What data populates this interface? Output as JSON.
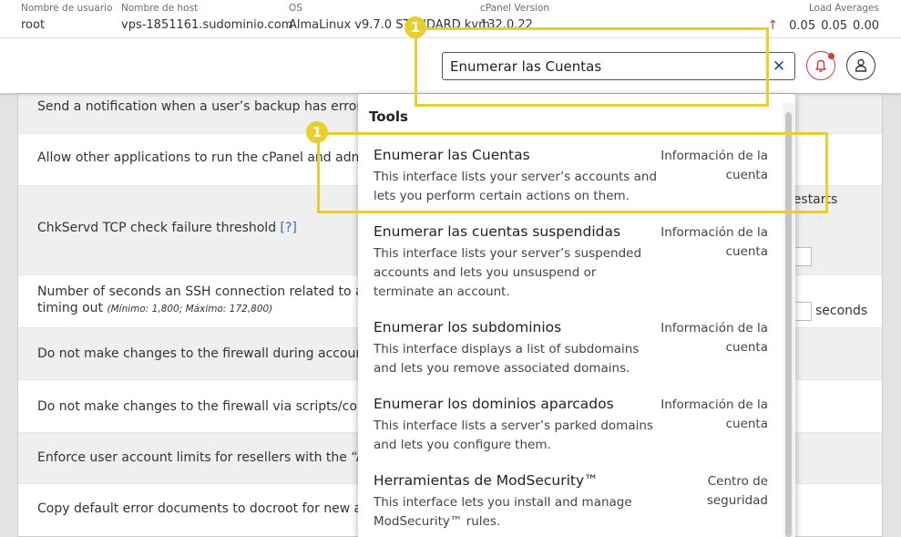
{
  "infobar": {
    "columns": [
      {
        "header": "Nombre de usuario",
        "value": "root"
      },
      {
        "header": "Nombre de host",
        "value": "vps-1851161.sudominio.com"
      },
      {
        "header": "OS",
        "value": "AlmaLinux v9.7.0 STANDARD kvm"
      },
      {
        "header": "cPanel Version",
        "value": "132.0.22"
      }
    ],
    "load_header": "Load Averages",
    "load_values": [
      "0.05",
      "0.05",
      "0.00"
    ],
    "load_trend_icon": "arrow-up-icon",
    "trend_color": "#d43a3a"
  },
  "search": {
    "value": "Enumerar las Cuentas",
    "clear_label": "✕"
  },
  "settings_rows": [
    {
      "label": "Send a notification when a user’s backup has errors"
    },
    {
      "label": "Allow other applications to run the cPanel and admin b"
    },
    {
      "label": "ChkServd TCP check failure threshold",
      "help": "[?]",
      "fragment": "l restarts"
    },
    {
      "label": "Number of seconds an SSH connection related to an a",
      "label2": "timing out",
      "note": "(Mínimo: 1,800; Máximo: 172,800)",
      "fragment": "seconds"
    },
    {
      "label": "Do not make changes to the firewall during account m"
    },
    {
      "label": "Do not make changes to the firewall via scripts/configu"
    },
    {
      "label": "Enforce user account limits for resellers with the “Acco"
    },
    {
      "label": "Copy default error documents to docroot for new acco"
    }
  ],
  "dropdown": {
    "heading": "Tools",
    "items": [
      {
        "title": "Enumerar las Cuentas",
        "description": "This interface lists your server’s accounts and lets you perform certain actions on them.",
        "category": "Información de la cuenta"
      },
      {
        "title": "Enumerar las cuentas suspendidas",
        "description": "This interface lists your server’s suspended accounts and lets you unsuspend or terminate an account.",
        "category": "Información de la cuenta"
      },
      {
        "title": "Enumerar los subdominios",
        "description": "This interface displays a list of subdomains and lets you remove associated domains.",
        "category": "Información de la cuenta"
      },
      {
        "title": "Enumerar los dominios aparcados",
        "description": "This interface lists a server’s parked domains and lets you configure them.",
        "category": "Información de la cuenta"
      },
      {
        "title": "Herramientas de ModSecurity™",
        "description": "This interface lets you install and manage ModSecurity™ rules.",
        "category": "Centro de seguridad"
      }
    ]
  },
  "annotations": [
    {
      "badge": "1",
      "target": "search-box"
    },
    {
      "badge": "1",
      "target": "first-result"
    }
  ],
  "colors": {
    "highlight": "#e8cf2e",
    "link": "#2a6ebb",
    "alert": "#d43a3a"
  }
}
